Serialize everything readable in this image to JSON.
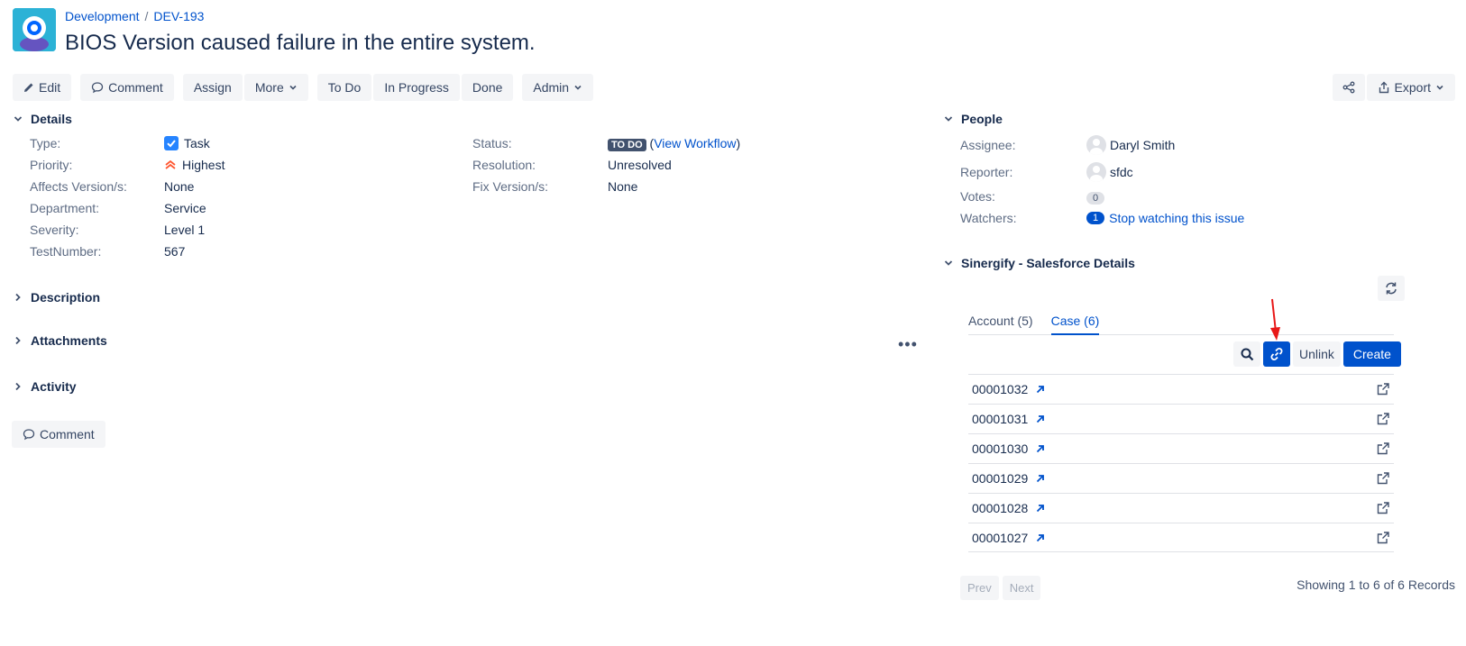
{
  "header": {
    "project": "Development",
    "issue_key": "DEV-193",
    "title": "BIOS Version caused failure in the entire system."
  },
  "toolbar": {
    "edit": "Edit",
    "comment": "Comment",
    "assign": "Assign",
    "more": "More",
    "todo": "To Do",
    "in_progress": "In Progress",
    "done": "Done",
    "admin": "Admin",
    "export": "Export"
  },
  "details": {
    "heading": "Details",
    "left": [
      {
        "label": "Type:",
        "value": "Task"
      },
      {
        "label": "Priority:",
        "value": "Highest"
      },
      {
        "label": "Affects Version/s:",
        "value": "None"
      },
      {
        "label": "Department:",
        "value": "Service"
      },
      {
        "label": "Severity:",
        "value": "Level 1"
      },
      {
        "label": "TestNumber:",
        "value": "567"
      }
    ],
    "right": [
      {
        "label": "Status:",
        "value": "TO DO",
        "link": "View Workflow"
      },
      {
        "label": "Resolution:",
        "value": "Unresolved"
      },
      {
        "label": "Fix Version/s:",
        "value": "None"
      }
    ]
  },
  "sections": {
    "description": "Description",
    "attachments": "Attachments",
    "activity": "Activity",
    "comment_button": "Comment",
    "more_dots": "•••"
  },
  "people": {
    "heading": "People",
    "assignee_label": "Assignee:",
    "assignee": "Daryl Smith",
    "reporter_label": "Reporter:",
    "reporter": "sfdc",
    "votes_label": "Votes:",
    "votes": "0",
    "watchers_label": "Watchers:",
    "watchers": "1",
    "watch_link": "Stop watching this issue"
  },
  "sinergify": {
    "heading": "Sinergify - Salesforce Details",
    "tabs": [
      "Account (5)",
      "Case (6)"
    ],
    "active_tab": "Case (6)",
    "unlink": "Unlink",
    "create": "Create",
    "records": [
      "00001032",
      "00001031",
      "00001030",
      "00001029",
      "00001028",
      "00001027"
    ],
    "prev": "Prev",
    "next": "Next",
    "showing": "Showing 1 to 6 of 6 Records"
  },
  "colors": {
    "link": "#0052cc",
    "primary": "#0052cc",
    "lozenge": "#42526e",
    "priority": "#ff5630",
    "annotation": "#e81818"
  },
  "icons": [
    "project-avatar-icon",
    "pencil-icon",
    "comment-icon",
    "chevron-down-icon",
    "share-icon",
    "export-icon",
    "checkbox-task-icon",
    "priority-highest-icon",
    "refresh-icon",
    "search-icon",
    "link-icon",
    "arrow-up-right-icon",
    "external-link-icon"
  ]
}
